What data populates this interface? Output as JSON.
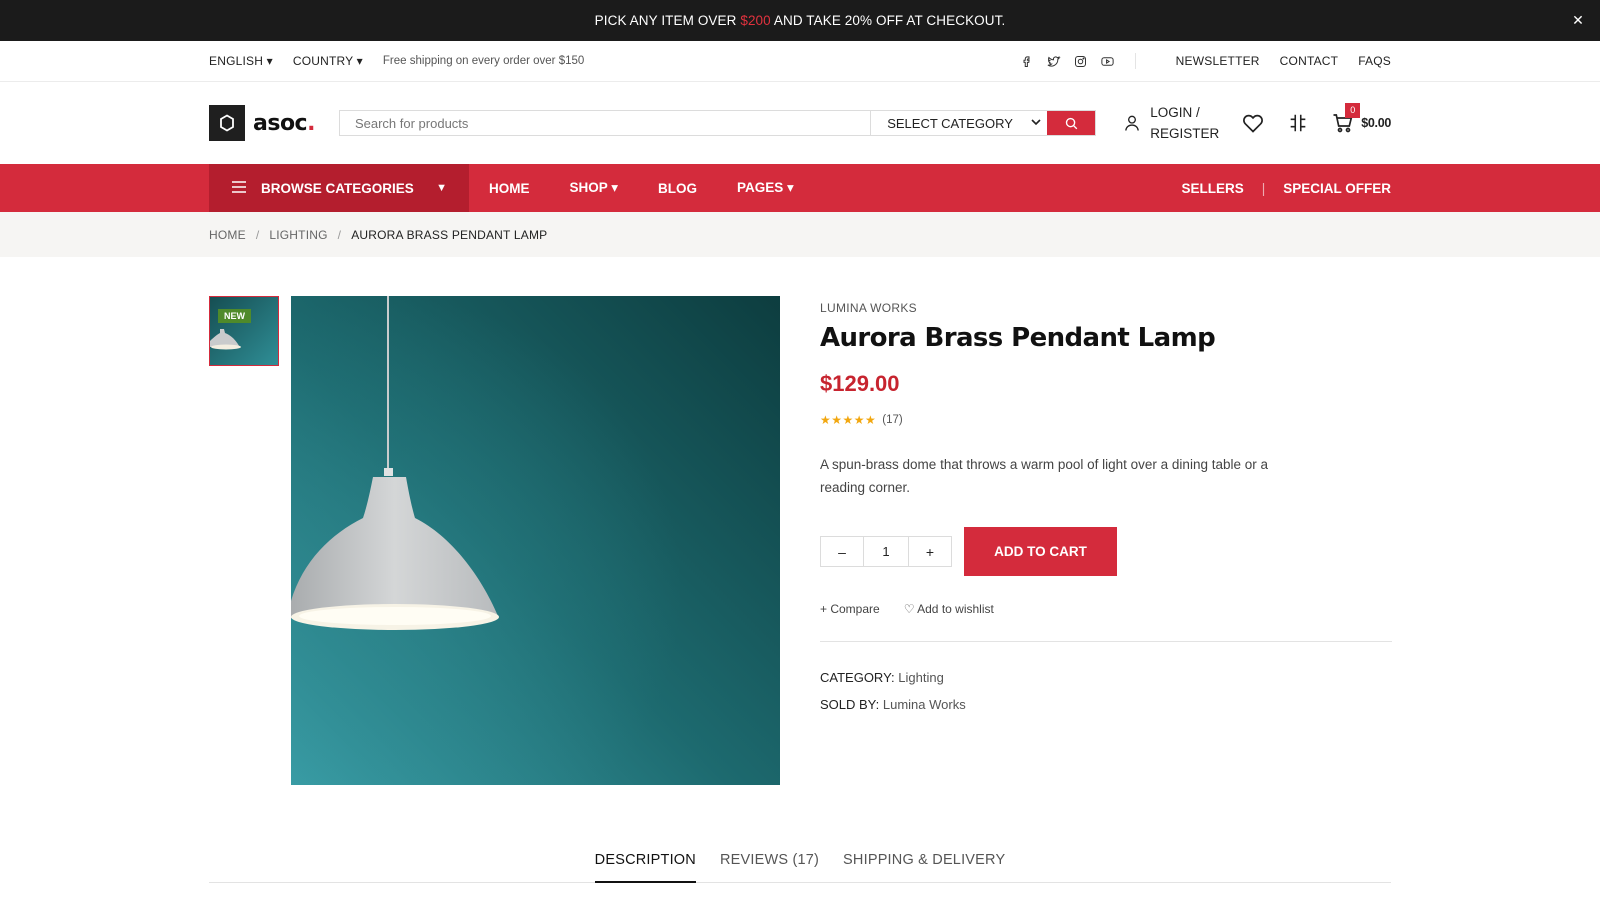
{
  "promo": {
    "text_before": "PICK ANY ITEM OVER ",
    "amount": "$200",
    "text_after": " AND TAKE 20% OFF AT CHECKOUT.",
    "close_label": "✕"
  },
  "topbar": {
    "language": "ENGLISH ▾",
    "country": "COUNTRY ▾",
    "shipping_note": "Free shipping on every order over $150",
    "social_icons": [
      "facebook-icon",
      "twitter-icon",
      "instagram-icon",
      "youtube-icon"
    ],
    "links": [
      "NEWSLETTER",
      "CONTACT",
      "FAQS"
    ]
  },
  "header": {
    "logo_text": "asoc",
    "logo_dot": ".",
    "search_placeholder": "Search for products",
    "category_label": "SELECT CATEGORY",
    "account_line1": "LOGIN /",
    "account_line2": "REGISTER",
    "cart_count": "0",
    "cart_total": "$0.00"
  },
  "nav": {
    "browse_label": "BROWSE CATEGORIES",
    "items": [
      "HOME",
      "SHOP ▾",
      "BLOG",
      "PAGES ▾"
    ],
    "right_items": [
      "SELLERS",
      "SPECIAL OFFER"
    ]
  },
  "breadcrumb": [
    "HOME",
    "LIGHTING",
    "AURORA BRASS PENDANT LAMP"
  ],
  "gallery": {
    "badge": "NEW"
  },
  "product": {
    "vendor": "LUMINA WORKS",
    "title": "Aurora Brass Pendant Lamp",
    "price": "$129.00",
    "rating_stars": "★★★★★",
    "rating_count": "(17)",
    "description": "A spun-brass dome that throws a warm pool of light over a dining table or a reading corner.",
    "quantity": "1",
    "qty_minus": "–",
    "qty_plus": "+",
    "add_to_cart": "ADD TO CART",
    "compare": "+ Compare",
    "wishlist": "♡ Add to wishlist",
    "category_label": "CATEGORY:",
    "category_value": "Lighting",
    "sold_by_label": "SOLD BY:",
    "sold_by_value": "Lumina Works"
  },
  "tabs": [
    "DESCRIPTION",
    "REVIEWS (17)",
    "SHIPPING & DELIVERY"
  ],
  "colors": {
    "accent": "#d42b3c",
    "accent_dark": "#b41e2e",
    "price": "#c7242f",
    "promo_bg": "#1b1b1b",
    "new_badge": "#4f8a2a",
    "star": "#f2a70f"
  }
}
